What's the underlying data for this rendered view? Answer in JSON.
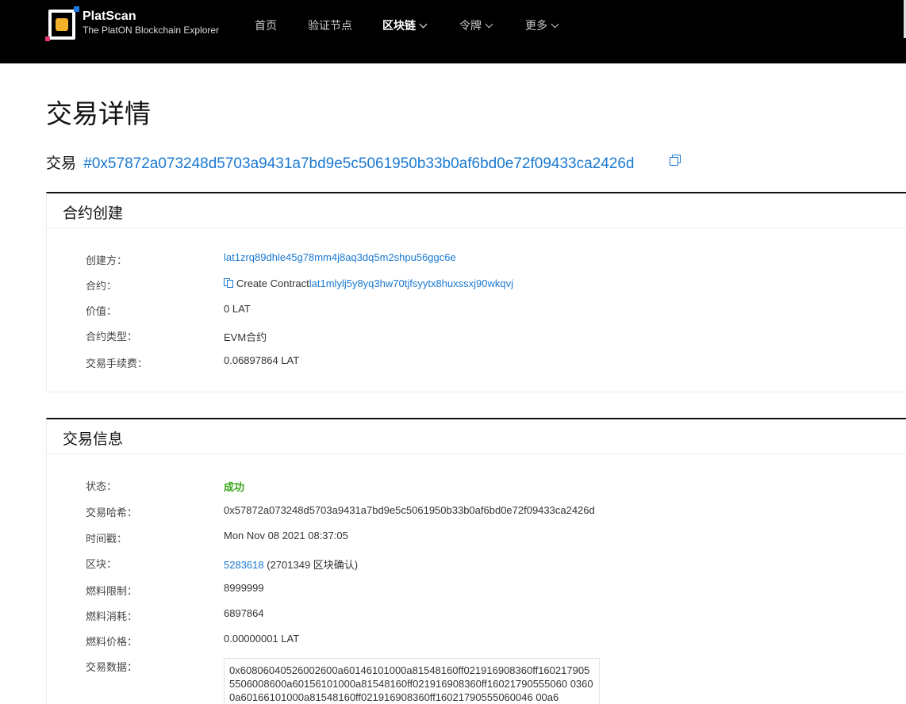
{
  "header": {
    "brand_name": "PlatScan",
    "brand_sub": "The PlatON Blockchain Explorer",
    "nav": [
      {
        "label": "首页",
        "dropdown": false,
        "active": false
      },
      {
        "label": "验证节点",
        "dropdown": false,
        "active": false
      },
      {
        "label": "区块链",
        "dropdown": true,
        "active": true
      },
      {
        "label": "令牌",
        "dropdown": true,
        "active": false
      },
      {
        "label": "更多",
        "dropdown": true,
        "active": false
      }
    ]
  },
  "page": {
    "title": "交易详情",
    "tx_label": "交易",
    "tx_hash": "#0x57872a073248d5703a9431a7bd9e5c5061950b33b0af6bd0e72f09433ca2426d"
  },
  "contract_card": {
    "title": "合约创建",
    "rows": {
      "creator_label": "创建方：",
      "creator_value": "lat1zrq89dhle45g78mm4j8aq3dq5m2shpu56ggc6e",
      "contract_label": "合约：",
      "contract_prefix": "Create Contract",
      "contract_value": "lat1mlylj5y8yq3hw70tjfsyytx8huxssxj90wkqvj",
      "value_label": "价值：",
      "value_value": "0 LAT",
      "type_label": "合约类型：",
      "type_value": "EVM合约",
      "fee_label": "交易手续费：",
      "fee_value": "0.06897864 LAT"
    }
  },
  "tx_card": {
    "title": "交易信息",
    "rows": {
      "status_label": "状态：",
      "status_value": "成功",
      "hash_label": "交易哈希：",
      "hash_value": "0x57872a073248d5703a9431a7bd9e5c5061950b33b0af6bd0e72f09433ca2426d",
      "time_label": "时间戳：",
      "time_value": "Mon Nov 08 2021 08:37:05",
      "block_label": "区块：",
      "block_number": "5283618",
      "block_confirm": "(2701349 区块确认)",
      "gas_limit_label": "燃料限制：",
      "gas_limit_value": "8999999",
      "gas_used_label": "燃料消耗：",
      "gas_used_value": "6897864",
      "gas_price_label": "燃料价格：",
      "gas_price_value": "0.00000001 LAT",
      "input_label": "交易数据：",
      "input_value": "0x60806040526002600a60146101000a81548160ff021916908360ff1602179055506008600a60156101000a81548160ff021916908360ff16021790555060 03600a60166101000a81548160ff021916908360ff16021790555060046 00a6"
    }
  },
  "colors": {
    "link": "#1a79d2",
    "success": "#3aa61b",
    "header_bg": "#000000",
    "logo_accent": "#f3b12b"
  }
}
